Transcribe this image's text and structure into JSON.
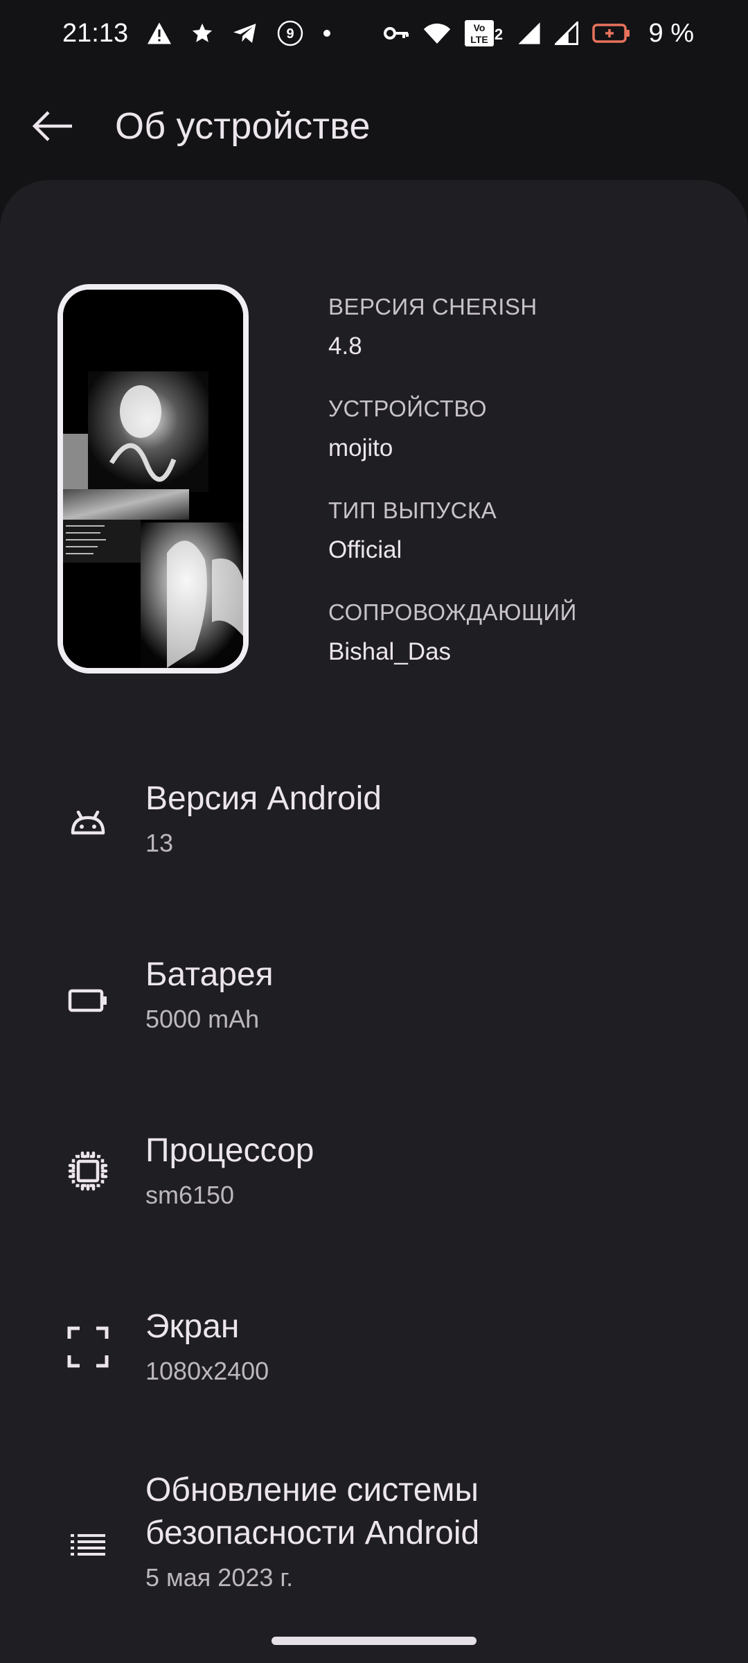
{
  "status_bar": {
    "time": "21:13",
    "notification_count": "9",
    "battery_percent": "9 %",
    "icons": [
      "warning-icon",
      "star-icon",
      "telegram-icon",
      "badge-icon",
      "dot-icon",
      "vpn-key-icon",
      "wifi-icon",
      "volte-icon",
      "signal-icon",
      "signal-icon",
      "battery-saver-icon"
    ],
    "volte_label": "Vo LTE 2"
  },
  "toolbar": {
    "title": "Об устройстве",
    "back_icon": "arrow-back-icon"
  },
  "device_info": {
    "items": [
      {
        "label": "ВЕРСИЯ CHERISH",
        "value": "4.8"
      },
      {
        "label": "УСТРОЙСТВО",
        "value": "mojito"
      },
      {
        "label": "ТИП ВЫПУСКА",
        "value": "Official"
      },
      {
        "label": "СОПРОВОЖДАЮЩИЙ",
        "value": "Bishal_Das"
      }
    ]
  },
  "preferences": [
    {
      "title": "Версия Android",
      "summary": "13",
      "icon": "android-icon"
    },
    {
      "title": "Батарея",
      "summary": "5000 mAh",
      "icon": "battery-icon"
    },
    {
      "title": "Процессор",
      "summary": "sm6150",
      "icon": "processor-icon"
    },
    {
      "title": "Экран",
      "summary": "1080x2400",
      "icon": "fullscreen-icon"
    },
    {
      "title": "Обновление системы безопасности Android",
      "summary": "5 мая 2023 г.",
      "icon": "list-icon"
    }
  ],
  "colors": {
    "background": "#131316",
    "card": "#1f1e22",
    "text_primary": "#ece6ec",
    "text_secondary": "#bdb8be",
    "battery_accent": "#e8735d"
  }
}
